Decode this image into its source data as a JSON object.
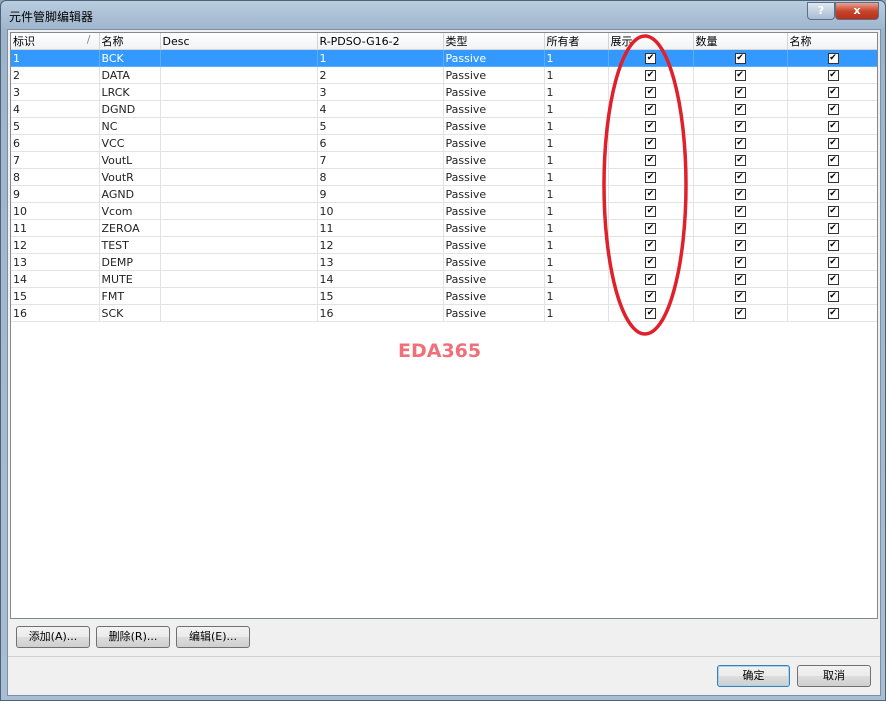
{
  "window": {
    "title": "元件管脚编辑器",
    "help": "?",
    "close": "x"
  },
  "columns": [
    "标识",
    "名称",
    "Desc",
    "R-PDSO-G16-2",
    "类型",
    "所有者",
    "展示",
    "数量",
    "名称"
  ],
  "sort_indicator": "/",
  "rows": [
    [
      "1",
      "BCK",
      "",
      "1",
      "Passive",
      "1"
    ],
    [
      "2",
      "DATA",
      "",
      "2",
      "Passive",
      "1"
    ],
    [
      "3",
      "LRCK",
      "",
      "3",
      "Passive",
      "1"
    ],
    [
      "4",
      "DGND",
      "",
      "4",
      "Passive",
      "1"
    ],
    [
      "5",
      "NC",
      "",
      "5",
      "Passive",
      "1"
    ],
    [
      "6",
      "VCC",
      "",
      "6",
      "Passive",
      "1"
    ],
    [
      "7",
      "VoutL",
      "",
      "7",
      "Passive",
      "1"
    ],
    [
      "8",
      "VoutR",
      "",
      "8",
      "Passive",
      "1"
    ],
    [
      "9",
      "AGND",
      "",
      "9",
      "Passive",
      "1"
    ],
    [
      "10",
      "Vcom",
      "",
      "10",
      "Passive",
      "1"
    ],
    [
      "11",
      "ZEROA",
      "",
      "11",
      "Passive",
      "1"
    ],
    [
      "12",
      "TEST",
      "",
      "12",
      "Passive",
      "1"
    ],
    [
      "13",
      "DEMP",
      "",
      "13",
      "Passive",
      "1"
    ],
    [
      "14",
      "MUTE",
      "",
      "14",
      "Passive",
      "1"
    ],
    [
      "15",
      "FMT",
      "",
      "15",
      "Passive",
      "1"
    ],
    [
      "16",
      "SCK",
      "",
      "16",
      "Passive",
      "1"
    ]
  ],
  "checked": true,
  "selected_row": 0,
  "watermark": "EDA365",
  "buttons": {
    "add": "添加(A)...",
    "delete": "删除(R)...",
    "edit": "编辑(E)...",
    "ok": "确定",
    "cancel": "取消"
  },
  "annotation_color": "#e0202a"
}
